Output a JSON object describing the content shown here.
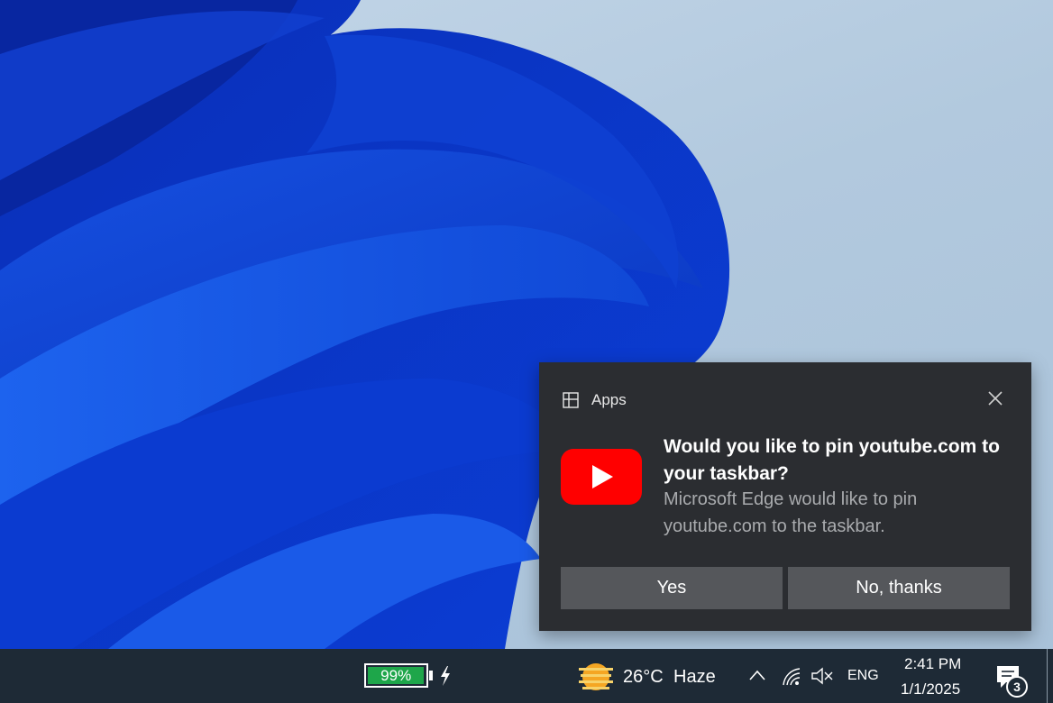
{
  "notification": {
    "app_label": "Apps",
    "title": "Would you like to pin youtube.com to your taskbar?",
    "body": "Microsoft Edge would like to pin youtube.com to the taskbar.",
    "buttons": {
      "yes": "Yes",
      "no": "No, thanks"
    },
    "icons": {
      "app": "apps-grid-icon",
      "close": "close-icon",
      "logo": "youtube-logo-icon"
    }
  },
  "taskbar": {
    "battery": {
      "percent_label": "99%",
      "level": 0.99,
      "charging": true
    },
    "weather": {
      "temp": "26°C",
      "desc": "Haze"
    },
    "language": "ENG",
    "clock": {
      "time": "2:41 PM",
      "date": "1/1/2025"
    },
    "notification_count": "3"
  },
  "colors": {
    "toast_bg": "#2b2d31",
    "button_bg": "#55575b",
    "youtube_red": "#ff0000",
    "taskbar_bg": "#1e2a36",
    "battery_green": "#1ea64a"
  }
}
